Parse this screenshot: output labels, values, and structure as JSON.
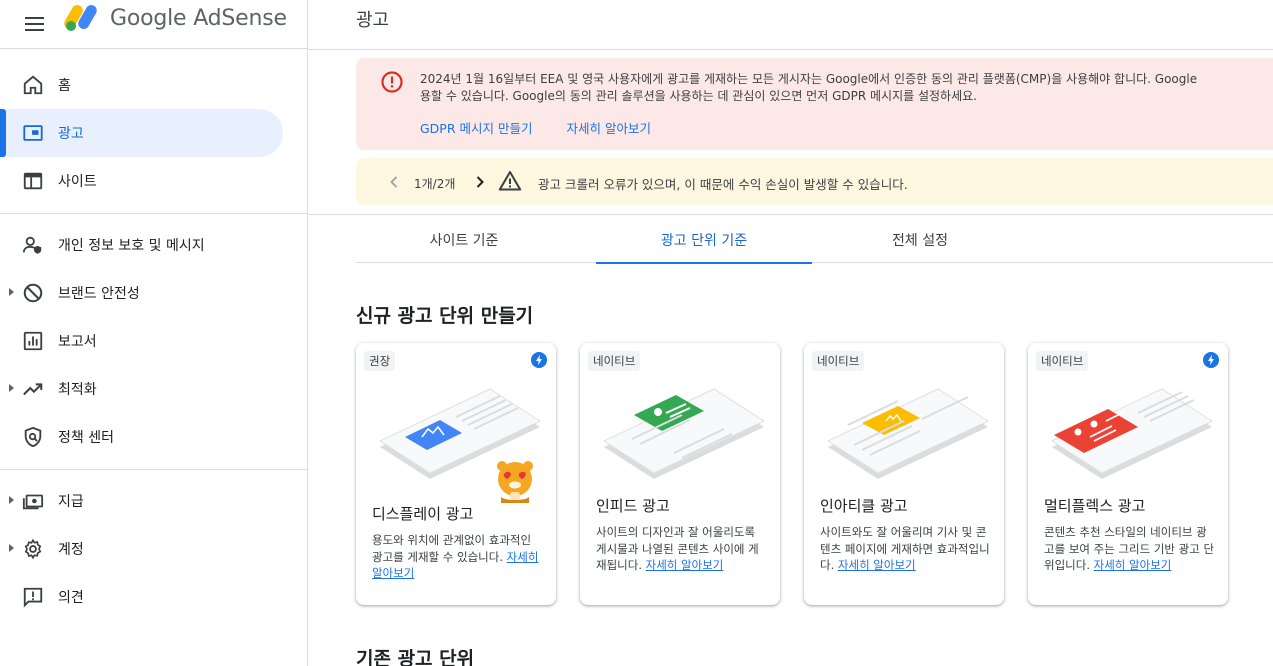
{
  "app": {
    "brand_google": "Google",
    "brand_product": "AdSense"
  },
  "page": {
    "title": "광고"
  },
  "sidebar": {
    "items": [
      {
        "label": "홈",
        "icon": "home-icon"
      },
      {
        "label": "광고",
        "icon": "ads-icon",
        "active": true
      },
      {
        "label": "사이트",
        "icon": "sites-icon"
      },
      {
        "label": "개인 정보 보호 및 메시지",
        "icon": "privacy-icon"
      },
      {
        "label": "브랜드 안전성",
        "icon": "block-icon",
        "expandable": true
      },
      {
        "label": "보고서",
        "icon": "reports-icon"
      },
      {
        "label": "최적화",
        "icon": "trending-icon",
        "expandable": true
      },
      {
        "label": "정책 센터",
        "icon": "policy-shield-icon"
      },
      {
        "label": "지급",
        "icon": "payments-icon",
        "expandable": true
      },
      {
        "label": "계정",
        "icon": "gear-icon",
        "expandable": true
      },
      {
        "label": "의견",
        "icon": "feedback-icon"
      }
    ]
  },
  "alert_error": {
    "line1": "2024년 1월 16일부터 EEA 및 영국 사용자에게 광고를 게재하는 모든 게시자는 Google에서 인증한 동의 관리 플랫폼(CMP)을 사용해야 합니다. Google",
    "line2": "용할 수 있습니다. Google의 동의 관리 솔루션을 사용하는 데 관심이 있으면 먼저 GDPR 메시지를 설정하세요.",
    "link_gdpr": "GDPR 메시지 만들기",
    "link_learn": "자세히 알아보기"
  },
  "alert_warning": {
    "pager": "1개/2개",
    "message": "광고 크롤러 오류가 있으며, 이 때문에 수익 손실이 발생할 수 있습니다."
  },
  "tabs": [
    {
      "label": "사이트 기준"
    },
    {
      "label": "광고 단위 기준",
      "active": true
    },
    {
      "label": "전체 설정"
    }
  ],
  "new_units": {
    "title": "신규 광고 단위 만들기",
    "cards": [
      {
        "badge": "권장",
        "title": "디스플레이 광고",
        "desc": "용도와 위치에 관계없이 효과적인 광고를 게재할 수 있습니다.",
        "link": "자세히 알아보기",
        "bolt": true,
        "accent": "#4285f4"
      },
      {
        "badge": "네이티브",
        "title": "인피드 광고",
        "desc": "사이트의 디자인과 잘 어울리도록 게시물과 나열된 콘텐츠 사이에 게재됩니다.",
        "link": "자세히 알아보기",
        "bolt": false,
        "accent": "#34a853"
      },
      {
        "badge": "네이티브",
        "title": "인아티클 광고",
        "desc": "사이트와도 잘 어울리며 기사 및 콘텐츠 페이지에 게재하면 효과적입니다.",
        "link": "자세히 알아보기",
        "bolt": false,
        "accent": "#fbbc04"
      },
      {
        "badge": "네이티브",
        "title": "멀티플렉스 광고",
        "desc": "콘텐츠 추천 스타일의 네이티브 광고를 보여 주는 그리드 기반 광고 단위입니다.",
        "link": "자세히 알아보기",
        "bolt": true,
        "accent": "#ea4335"
      }
    ]
  },
  "existing_units": {
    "title": "기존 광고 단위"
  },
  "colors": {
    "accent_blue": "#1a73e8",
    "error_bg": "#fce8e6",
    "warning_bg": "#fef7e0",
    "error_red": "#d93025"
  }
}
